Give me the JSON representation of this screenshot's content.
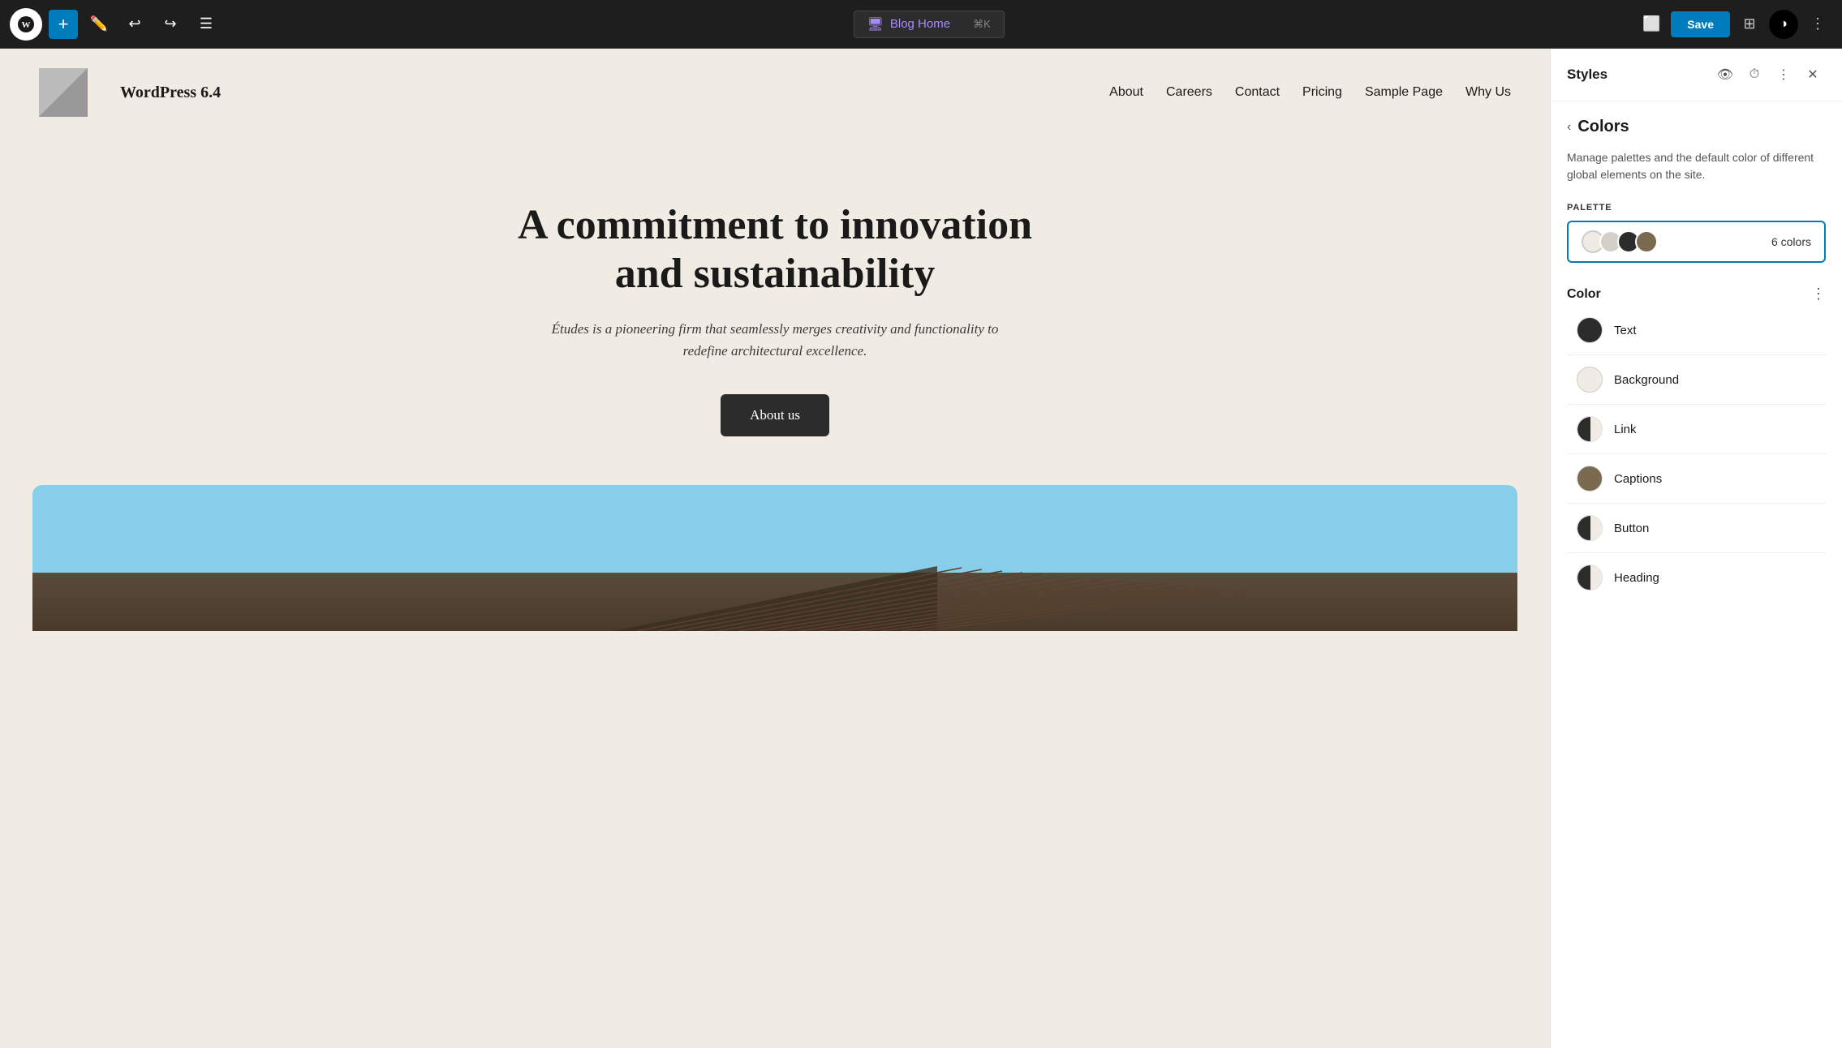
{
  "toolbar": {
    "add_label": "+",
    "save_label": "Save",
    "blog_home_label": "Blog Home",
    "shortcut": "⌘K"
  },
  "site": {
    "name": "WordPress 6.4",
    "nav_items": [
      "About",
      "Careers",
      "Contact",
      "Pricing",
      "Sample Page",
      "Why Us"
    ],
    "hero_heading": "A commitment to innovation and sustainability",
    "hero_para": "Études is a pioneering firm that seamlessly merges creativity and functionality to redefine architectural excellence.",
    "hero_btn": "About us"
  },
  "panel": {
    "title": "Styles",
    "section": "Colors",
    "description": "Manage palettes and the default color of different global elements on the site.",
    "palette_label": "PALETTE",
    "palette_count": "6 colors",
    "palette_swatches": [
      {
        "color": "#f0ece3"
      },
      {
        "color": "#d4d0c8"
      },
      {
        "color": "#2c2c2c"
      },
      {
        "color": "#7a6a50"
      }
    ],
    "color_section_label": "Color",
    "colors": [
      {
        "name": "Text",
        "type": "solid",
        "color": "#2c2c2c"
      },
      {
        "name": "Background",
        "type": "solid",
        "color": "#f0ece3"
      },
      {
        "name": "Link",
        "type": "half",
        "left": "#2c2c2c",
        "right": "#f0ece3"
      },
      {
        "name": "Captions",
        "type": "solid",
        "color": "#7a6a50"
      },
      {
        "name": "Button",
        "type": "half",
        "left": "#2c2c2c",
        "right": "#f0ece3"
      },
      {
        "name": "Heading",
        "type": "half",
        "left": "#2c2c2c",
        "right": "#f0ece3"
      }
    ]
  }
}
